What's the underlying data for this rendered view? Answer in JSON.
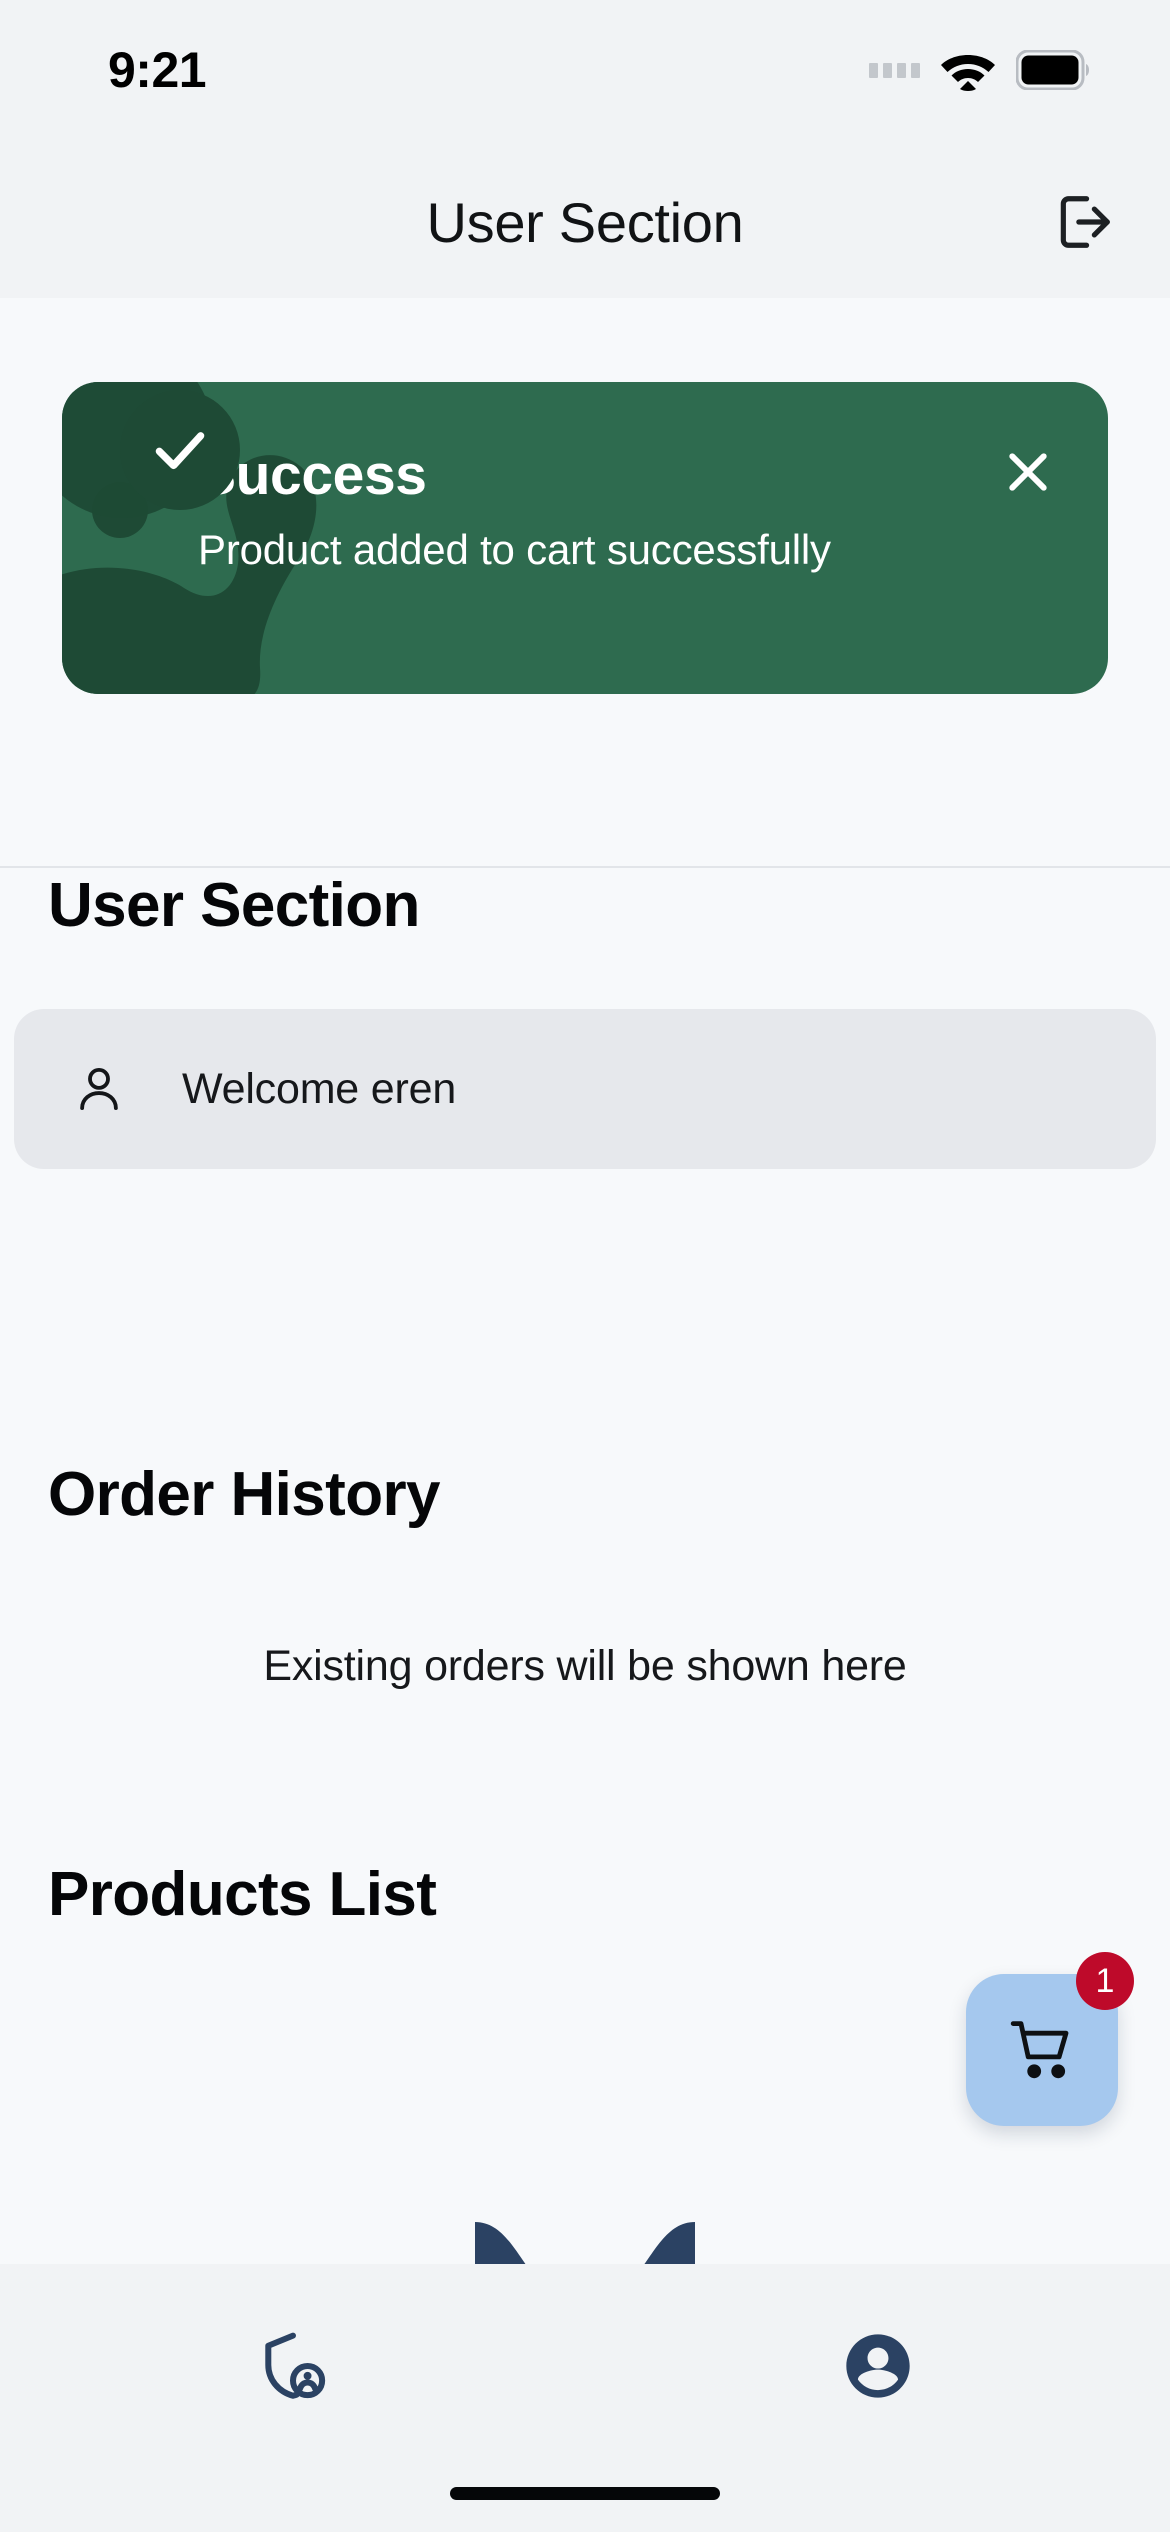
{
  "status_bar": {
    "time": "9:21",
    "signal_icon": "signal-dots-icon",
    "wifi_icon": "wifi-icon",
    "battery_icon": "battery-full-icon"
  },
  "app_bar": {
    "title": "User Section",
    "logout_icon": "logout-icon"
  },
  "toast": {
    "title": "Success",
    "message": "Product added to cart successfully",
    "check_icon": "check-icon",
    "close_icon": "close-icon",
    "background_color": "#2E6B4F",
    "accent_color": "#1E4A35"
  },
  "main": {
    "user_section_heading": "User Section",
    "welcome_text": "Welcome eren",
    "person_icon": "person-outline-icon",
    "order_history_heading": "Order History",
    "empty_orders_text": "Existing orders will be shown here",
    "products_list_heading": "Products List"
  },
  "fab": {
    "icon": "shopping-cart-icon",
    "badge_count": "1",
    "background_color": "#A5C8EE",
    "badge_color": "#BE0A2A"
  },
  "bottom_nav": {
    "items": [
      {
        "icon": "shield-person-icon",
        "name": "admin-tab"
      },
      {
        "icon": "account-circle-icon",
        "name": "user-tab"
      }
    ],
    "active_color": "#2B4263"
  }
}
